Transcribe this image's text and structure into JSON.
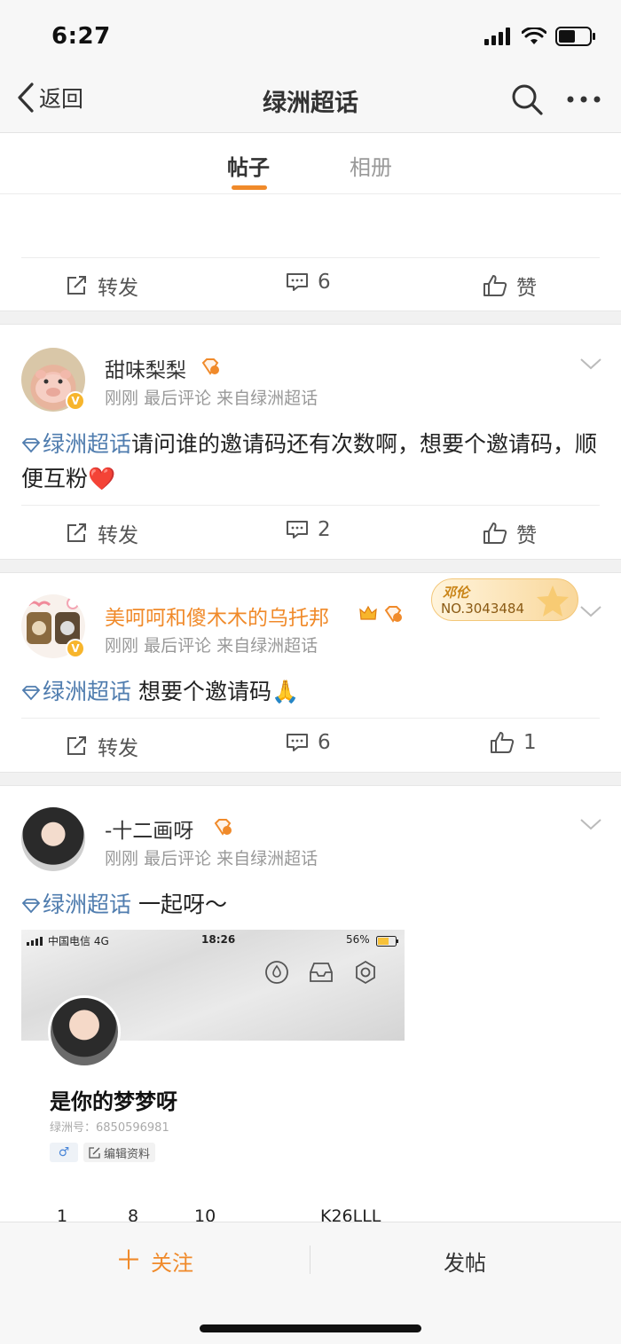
{
  "status_bar": {
    "time": "6:27"
  },
  "nav": {
    "back_label": "返回",
    "title": "绿洲超话"
  },
  "tabs": [
    {
      "label": "帖子"
    },
    {
      "label": "相册"
    }
  ],
  "action_labels": {
    "share": "转发",
    "like": "赞"
  },
  "posts": [
    {
      "comments": "6",
      "like": "赞"
    },
    {
      "username": "甜味梨梨",
      "time": "刚刚",
      "meta_last": "最后评论",
      "source": "来自绿洲超话",
      "topic": "绿洲超话",
      "text": "请问谁的邀请码还有次数啊，想要个邀请码，顺便互粉",
      "emoji": "❤️",
      "comments": "2",
      "like": "赞"
    },
    {
      "username": "美呵呵和傻木木的乌托邦",
      "time": "刚刚",
      "meta_last": "最后评论",
      "source": "来自绿洲超话",
      "topic": "绿洲超话",
      "text": " 想要个邀请码",
      "emoji": "🙏",
      "medal_name": "邓伦",
      "medal_no": "NO.3043484",
      "comments": "6",
      "likes": "1"
    },
    {
      "username": "-十二画呀",
      "time": "刚刚",
      "meta_last": "最后评论",
      "source": "来自绿洲超话",
      "topic": "绿洲超话",
      "text": "  一起呀～",
      "screenshot": {
        "carrier": "中国电信",
        "network": "4G",
        "time": "18:26",
        "battery": "56%",
        "name": "是你的梦梦呀",
        "id_line": "绿洲号：6850596981",
        "gender": "♂",
        "edit_label": "编辑资料",
        "stats": [
          "1",
          "8",
          "10",
          "K26LLL"
        ]
      }
    }
  ],
  "bottom_bar": {
    "follow_label": "关注",
    "follow_plus": "＋",
    "post_label": "发帖"
  },
  "colors": {
    "accent": "#f08a2a",
    "topic": "#507daf",
    "badge": "#f7b52c"
  }
}
